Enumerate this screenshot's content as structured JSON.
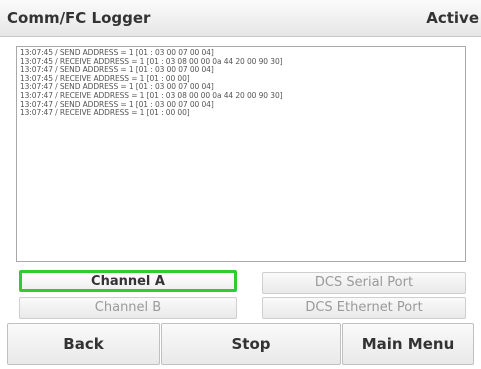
{
  "header": {
    "title": "Comm/FC Logger",
    "status": "Active"
  },
  "log": {
    "lines": [
      "13:07:45 / SEND ADDRESS = 1 [01 : 03 00 07 00 04]",
      "13:07:45 / RECEIVE ADDRESS = 1 [01 : 03 08 00 00 0a 44 20 00 90 30]",
      "13:07:47 / SEND ADDRESS = 1 [01 : 03 00 07 00 04]",
      "13:07:45 / RECEIVE ADDRESS = 1 [01 : 00 00]",
      "13:07:47 / SEND ADDRESS = 1 [01 : 03 00 07 00 04]",
      "13:07:47 / RECEIVE ADDRESS = 1 [01 : 03 08 00 00 0a 44 20 00 90 30]",
      "13:07:47 / SEND ADDRESS = 1 [01 : 03 00 07 00 04]",
      "13:07:47 / RECEIVE ADDRESS = 1 [01 : 00 00]"
    ]
  },
  "channels": {
    "channel_a": "Channel A",
    "channel_b": "Channel B",
    "dcs_serial": "DCS Serial Port",
    "dcs_ethernet": "DCS Ethernet Port"
  },
  "footer": {
    "back": "Back",
    "stop": "Stop",
    "main_menu": "Main Menu"
  },
  "colors": {
    "selected_border": "#2ecc2e"
  }
}
